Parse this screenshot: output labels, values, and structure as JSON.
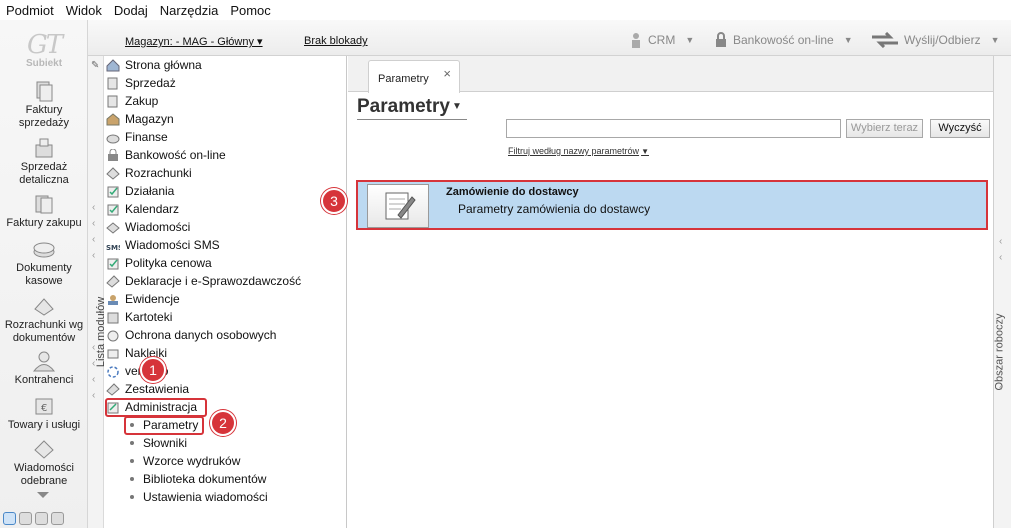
{
  "menu": [
    "Podmiot",
    "Widok",
    "Dodaj",
    "Narzędzia",
    "Pomoc"
  ],
  "logo": {
    "text": "Subiekt"
  },
  "sidebar_strip": [
    {
      "label": "Faktury sprzedaży",
      "icon": "invoice-sales-icon"
    },
    {
      "label": "Sprzedaż detaliczna",
      "icon": "retail-icon"
    },
    {
      "label": "Faktury zakupu",
      "icon": "invoice-purchase-icon"
    },
    {
      "label": "Dokumenty kasowe",
      "icon": "cash-documents-icon"
    },
    {
      "label": "Rozrachunki wg dokumentów",
      "icon": "settlements-icon"
    },
    {
      "label": "Kontrahenci",
      "icon": "contractors-icon"
    },
    {
      "label": "Towary i usługi",
      "icon": "goods-icon"
    },
    {
      "label": "Wiadomości odebrane",
      "icon": "received-messages-icon"
    }
  ],
  "toolbar": {
    "warehouse": "Magazyn: - MAG - Główny",
    "lock": "Brak blokady",
    "crm": "CRM",
    "banking": "Bankowość on-line",
    "send_receive": "Wyślij/Odbierz"
  },
  "modules_panel_label": "Lista modułów",
  "modules": [
    "Strona główna",
    "Sprzedaż",
    "Zakup",
    "Magazyn",
    "Finanse",
    "Bankowość on-line",
    "Rozrachunki",
    "Działania",
    "Kalendarz",
    "Wiadomości",
    "Wiadomości SMS",
    "Polityka cenowa",
    "Deklaracje i e-Sprawozdawczość",
    "Ewidencje",
    "Kartoteki",
    "Ochrona danych osobowych",
    "Naklejki",
    "vendero",
    "Zestawienia",
    "Administracja"
  ],
  "admin_submodules": [
    "Parametry",
    "Słowniki",
    "Wzorce wydruków",
    "Biblioteka dokumentów",
    "Ustawienia wiadomości"
  ],
  "badges": [
    "1",
    "2",
    "3"
  ],
  "main": {
    "tab_label": "Parametry",
    "tab_close": "×",
    "page_title": "Parametry",
    "search_placeholder": "",
    "btn_choose": "Wybierz teraz",
    "btn_clear": "Wyczyść",
    "filter_label": "Filtruj według nazwy parametrów",
    "result": {
      "title": "Zamówienie do dostawcy",
      "description": "Parametry zamówienia do dostawcy"
    }
  },
  "right_panel_label": "Obszar roboczy",
  "colors": {
    "highlight": "#d6343a",
    "selection": "#bcd9f1"
  }
}
